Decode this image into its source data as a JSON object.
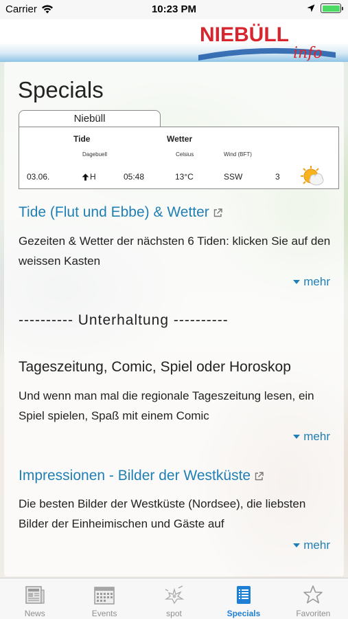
{
  "status_bar": {
    "carrier": "Carrier",
    "time": "10:23 PM"
  },
  "header": {
    "logo_main": "NIEBÜLL",
    "logo_sub": "info"
  },
  "page": {
    "title": "Specials"
  },
  "tide_widget": {
    "location_tab": "Niebüll",
    "tide_label": "Tide",
    "tide_sub": "Dagebuell",
    "weather_label": "Wetter",
    "celsius_label": "Celsius",
    "wind_label": "Wind (BFT)",
    "date": "03.06.",
    "tide_direction": "H",
    "time": "05:48",
    "temperature": "13°C",
    "wind_dir": "SSW",
    "wind_force": "3",
    "weather_icon": "sun-cloud-icon"
  },
  "sections": [
    {
      "title": "Tide (Flut und Ebbe) & Wetter",
      "text": "Gezeiten & Wetter der nächsten 6 Tiden: klicken Sie auf den weissen Kasten",
      "more": "mehr"
    },
    {
      "title": "Tageszeitung, Comic, Spiel oder Horoskop",
      "text": "Und wenn man mal die regionale Tageszeitung lesen, ein Spiel spielen, Spaß mit einem Comic",
      "more": "mehr"
    },
    {
      "title": "Impressionen - Bilder der Westküste",
      "text": "Die besten Bilder der Westküste (Nordsee), die liebsten Bilder der Einheimischen und Gäste auf",
      "more": "mehr"
    }
  ],
  "divider": "---------- Unterhaltung ----------",
  "tabbar": {
    "items": [
      {
        "label": "News",
        "icon": "newspaper-icon"
      },
      {
        "label": "Events",
        "icon": "calendar-icon"
      },
      {
        "label": "spot",
        "icon": "spot-icon"
      },
      {
        "label": "Specials",
        "icon": "list-icon"
      },
      {
        "label": "Favoriten",
        "icon": "star-icon"
      }
    ],
    "active": "Specials"
  },
  "colors": {
    "accent": "#1f7fb4",
    "tab_active": "#1f7fd4",
    "logo_red": "#d8262f",
    "logo_blue": "#1d5aa8"
  }
}
